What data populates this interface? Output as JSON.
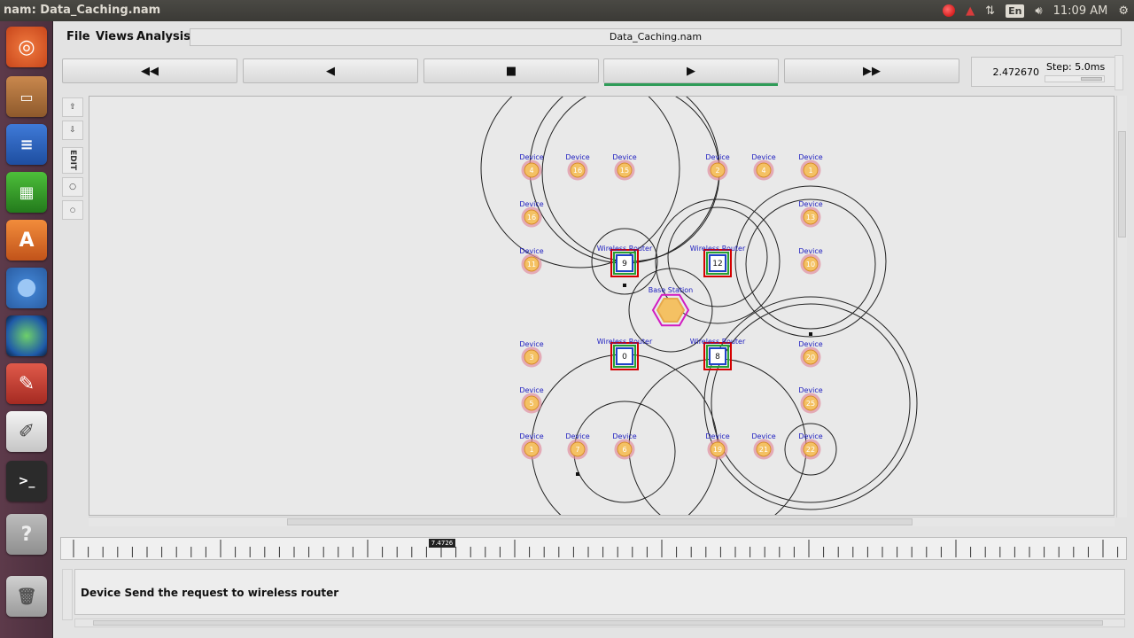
{
  "window_title": "nam: Data_Caching.nam",
  "tray": {
    "keyboard": "En",
    "clock": "11:09 AM"
  },
  "menu": {
    "file": "File",
    "views": "Views",
    "analysis": "Analysis"
  },
  "file_title": "Data_Caching.nam",
  "controls": {
    "rewind": "◀◀",
    "back": "◀",
    "stop": "■",
    "play": "▶",
    "fast_forward": "▶▶"
  },
  "time_value": "2.472670",
  "step_label": "Step: 5.0ms",
  "edit_tools": {
    "edit": "EDIT"
  },
  "timeline_marker": "7.4726",
  "annotation": "Device Send the request to wireless router",
  "topology": {
    "node_labels": {
      "device": "Device",
      "router": "Wireless Router",
      "base_station": "Base Station"
    },
    "devices": [
      "4",
      "16",
      "15",
      "2",
      "4",
      "1",
      "16",
      "13",
      "11",
      "10",
      "3",
      "20",
      "5",
      "25",
      "1",
      "7",
      "6",
      "19",
      "21",
      "22"
    ],
    "routers": [
      "9",
      "12",
      "0",
      "8"
    ],
    "colors": {
      "node_fill": "#f4c163",
      "node_ring": "#e18fa0",
      "router_outer": "#d40000",
      "router_mid": "#27a033",
      "router_inner": "#1f42c8",
      "base_station": "#d21cc1",
      "label": "#2020c0"
    }
  }
}
